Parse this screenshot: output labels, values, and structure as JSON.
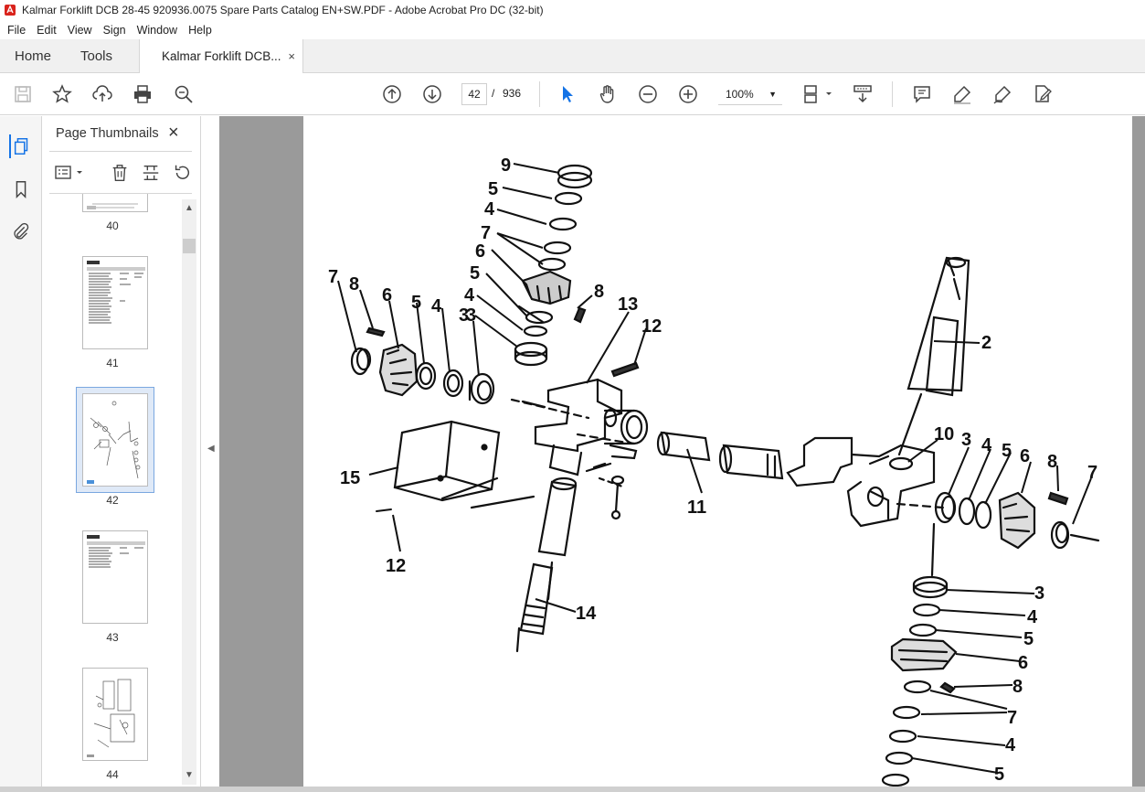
{
  "window": {
    "title": "Kalmar Forklift DCB 28-45 920936.0075 Spare Parts Catalog EN+SW.PDF - Adobe Acrobat Pro DC (32-bit)"
  },
  "menu": [
    "File",
    "Edit",
    "View",
    "Sign",
    "Window",
    "Help"
  ],
  "tabs": {
    "home": "Home",
    "tools": "Tools",
    "document": "Kalmar Forklift DCB...",
    "close": "×"
  },
  "toolbar": {
    "current_page": "42",
    "separator": "/",
    "total_pages": "936",
    "zoom": "100%",
    "icons": [
      "save-icon",
      "bookmark-star-icon",
      "upload-icon",
      "print-icon",
      "search-icon",
      "page-up-icon",
      "page-down-icon",
      "select-arrow-icon",
      "hand-icon",
      "zoom-out-icon",
      "zoom-in-icon",
      "page-display-icon",
      "scroll-mode-icon",
      "comment-icon",
      "highlight-icon",
      "sign-icon",
      "edit-pdf-icon"
    ]
  },
  "sidebar": {
    "title": "Page Thumbnails",
    "close": "×",
    "thumbnails": [
      {
        "label": "40"
      },
      {
        "label": "41"
      },
      {
        "label": "42",
        "selected": true
      },
      {
        "label": "43"
      },
      {
        "label": "44"
      }
    ]
  },
  "diagram": {
    "labels": [
      "9",
      "5",
      "4",
      "7",
      "6",
      "5",
      "4",
      "3",
      "8",
      "13",
      "12",
      "7",
      "8",
      "6",
      "5",
      "4",
      "3",
      "2",
      "10",
      "3",
      "4",
      "5",
      "6",
      "8",
      "7",
      "15",
      "12",
      "11",
      "14",
      "3",
      "4",
      "5",
      "6",
      "8",
      "7",
      "4",
      "5"
    ]
  },
  "colors": {
    "accent": "#1473e6",
    "viewer_bg": "#9a9a9a",
    "tabbar_bg": "#f0f0f0"
  }
}
